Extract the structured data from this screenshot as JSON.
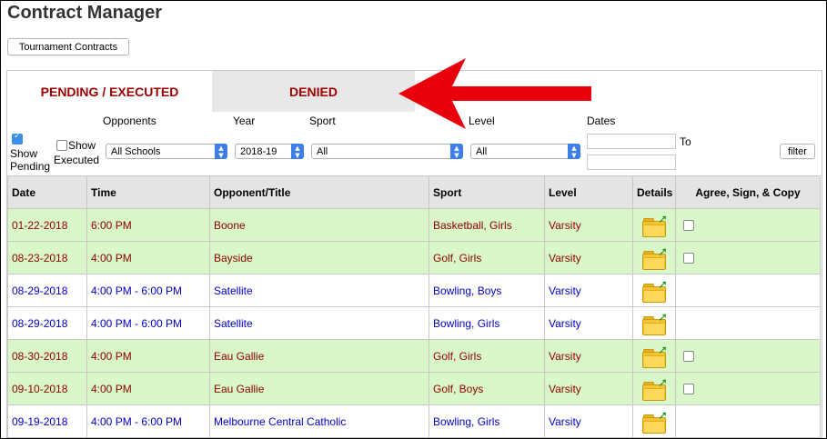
{
  "title": "Contract Manager",
  "tournament_button": "Tournament Contracts",
  "tabs": [
    {
      "label": "PENDING / EXECUTED",
      "active": true
    },
    {
      "label": "DENIED",
      "active": false
    }
  ],
  "filters": {
    "show_pending": {
      "label_1": "Show",
      "label_2": "Pending",
      "checked": true
    },
    "show_executed": {
      "label_1": "Show",
      "label_2": "Executed",
      "checked": false
    },
    "opponents": {
      "label": "Opponents",
      "value": "All Schools"
    },
    "year": {
      "label": "Year",
      "value": "2018-19"
    },
    "sport": {
      "label": "Sport",
      "value": "All"
    },
    "level": {
      "label": "Level",
      "value": "All"
    },
    "dates": {
      "label": "Dates",
      "to_label": "To",
      "from": "",
      "to": ""
    },
    "filter_button": "filter"
  },
  "table": {
    "headers": [
      "Date",
      "Time",
      "Opponent/Title",
      "Sport",
      "Level",
      "Details",
      "Agree, Sign, & Copy"
    ],
    "rows": [
      {
        "date": "01-22-2018",
        "time": "6:00 PM",
        "opponent": "Boone",
        "sport": "Basketball, Girls",
        "level": "Varsity",
        "status": "pending"
      },
      {
        "date": "08-23-2018",
        "time": "4:00 PM",
        "opponent": "Bayside",
        "sport": "Golf, Girls",
        "level": "Varsity",
        "status": "pending"
      },
      {
        "date": "08-29-2018",
        "time": "4:00 PM - 6:00 PM",
        "opponent": "Satellite",
        "sport": "Bowling, Boys",
        "level": "Varsity",
        "status": "executed"
      },
      {
        "date": "08-29-2018",
        "time": "4:00 PM - 6:00 PM",
        "opponent": "Satellite",
        "sport": "Bowling, Girls",
        "level": "Varsity",
        "status": "executed"
      },
      {
        "date": "08-30-2018",
        "time": "4:00 PM",
        "opponent": "Eau Gallie",
        "sport": "Golf, Girls",
        "level": "Varsity",
        "status": "pending"
      },
      {
        "date": "09-10-2018",
        "time": "4:00 PM",
        "opponent": "Eau Gallie",
        "sport": "Golf, Boys",
        "level": "Varsity",
        "status": "pending"
      },
      {
        "date": "09-19-2018",
        "time": "4:00 PM - 6:00 PM",
        "opponent": "Melbourne Central Catholic",
        "sport": "Bowling, Girls",
        "level": "Varsity",
        "status": "executed"
      }
    ]
  },
  "colors": {
    "pending_row_bg": "#d9f7c8",
    "pending_text": "#8b0000",
    "executed_text": "#0000cc",
    "tab_text": "#9b0000",
    "arrow": "#e8000b"
  },
  "icons": {
    "details": "folder-open-icon",
    "annotation": "red-arrow"
  }
}
